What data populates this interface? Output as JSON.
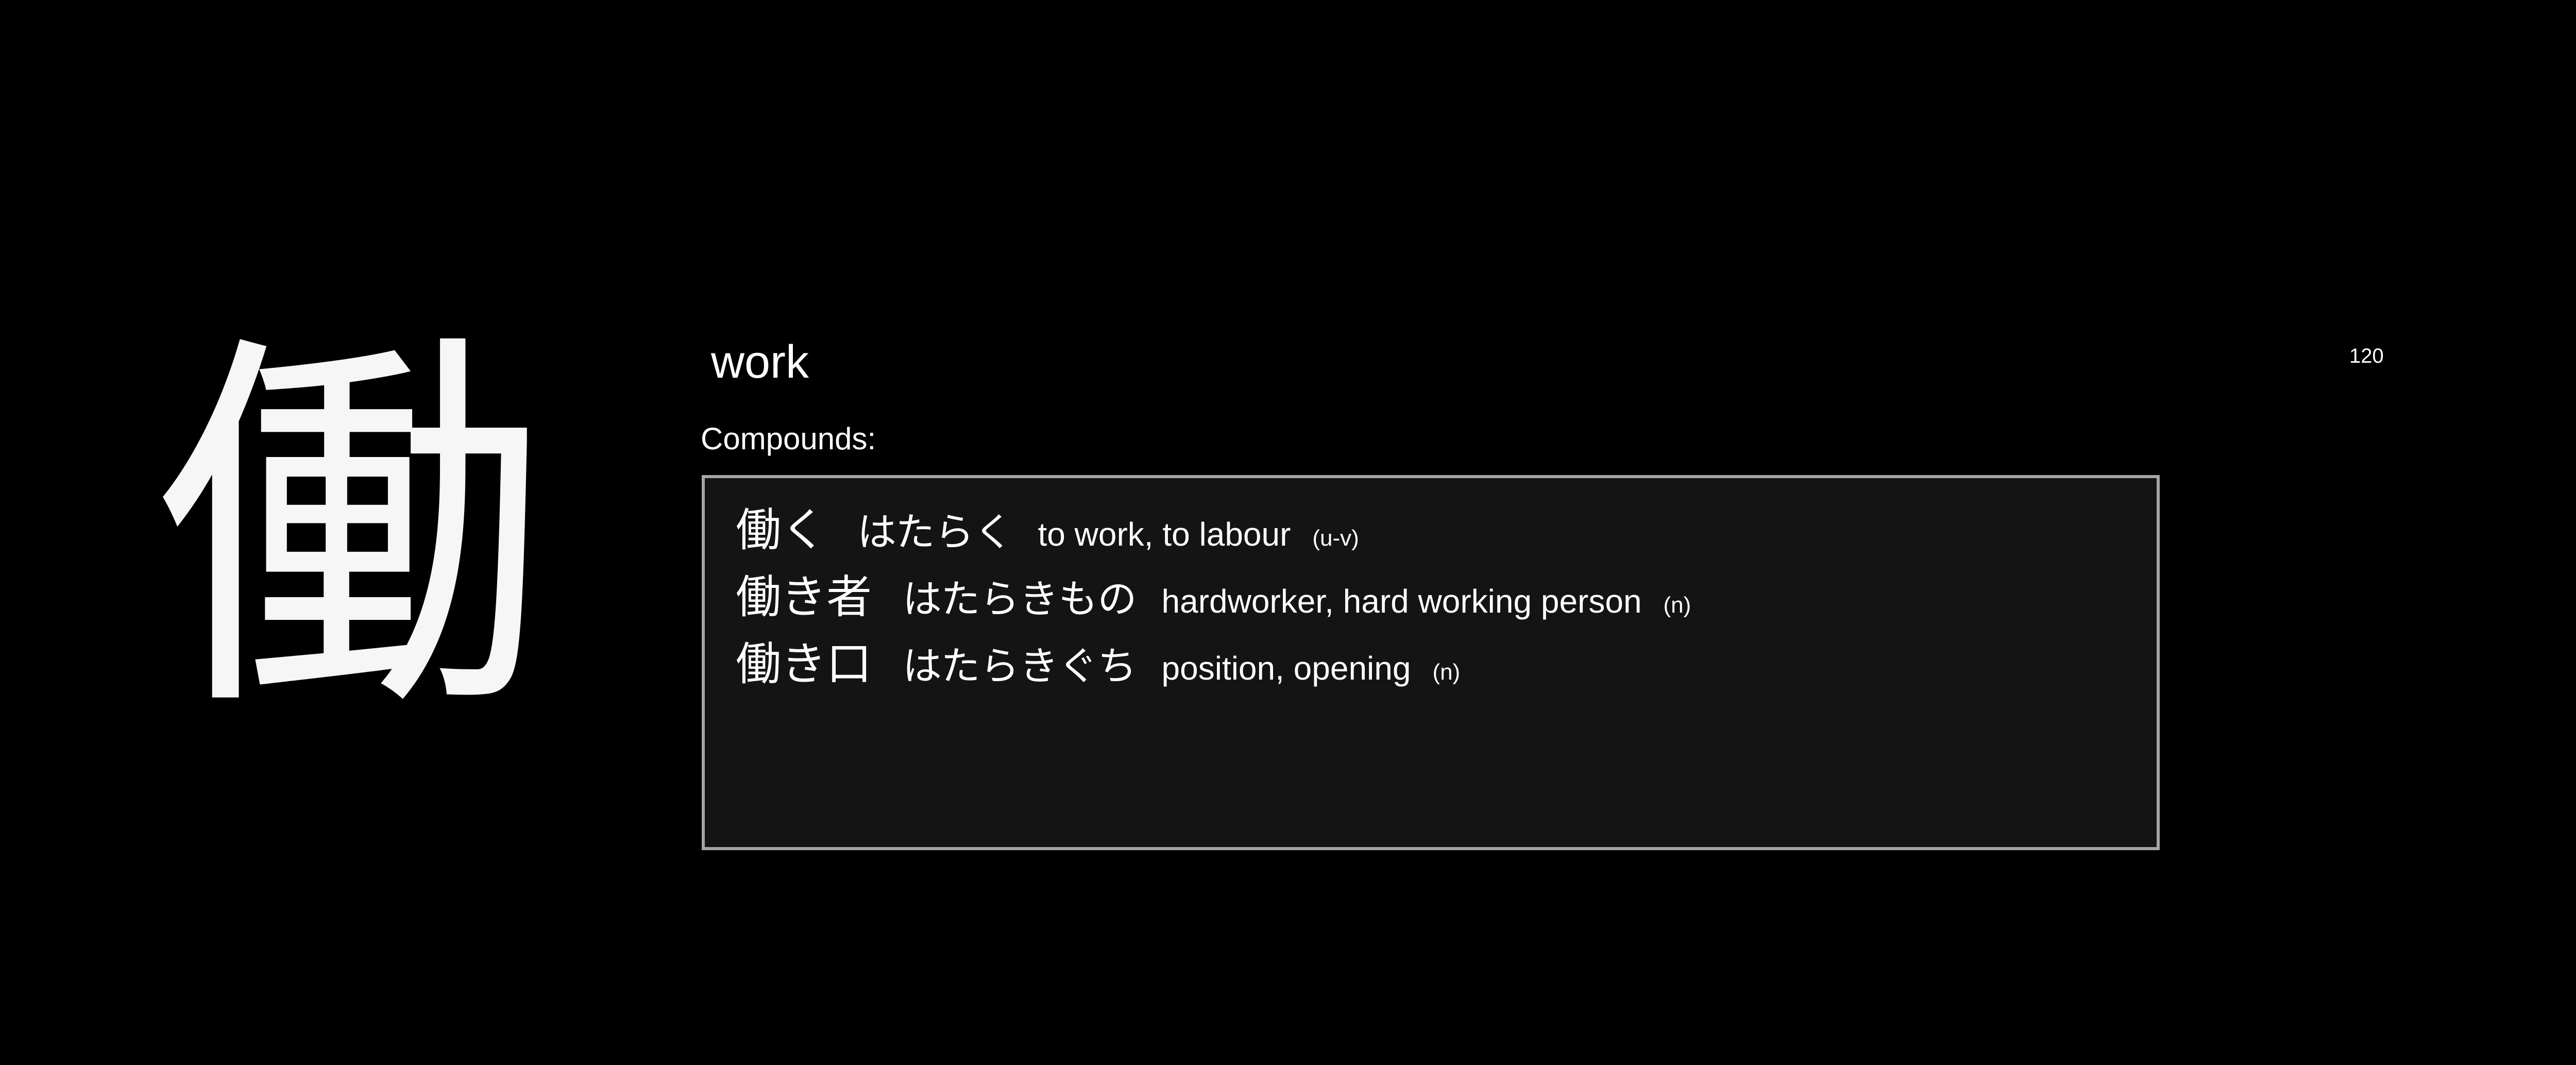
{
  "kanji": "働",
  "meaning": "work",
  "frequency": "120",
  "compounds_label": "Compounds:",
  "compounds": [
    {
      "word": "働く",
      "reading": "はたらく",
      "gloss": "to work, to labour",
      "pos": "(u-v)"
    },
    {
      "word": "働き者",
      "reading": "はたらきもの",
      "gloss": "hardworker, hard working person",
      "pos": "(n)"
    },
    {
      "word": "働き口",
      "reading": "はたらきぐち",
      "gloss": "position, opening",
      "pos": "(n)"
    }
  ],
  "colors": {
    "background": "#000000",
    "text": "#ffffff",
    "box_background": "#141414",
    "box_border": "#a4a4a4"
  }
}
